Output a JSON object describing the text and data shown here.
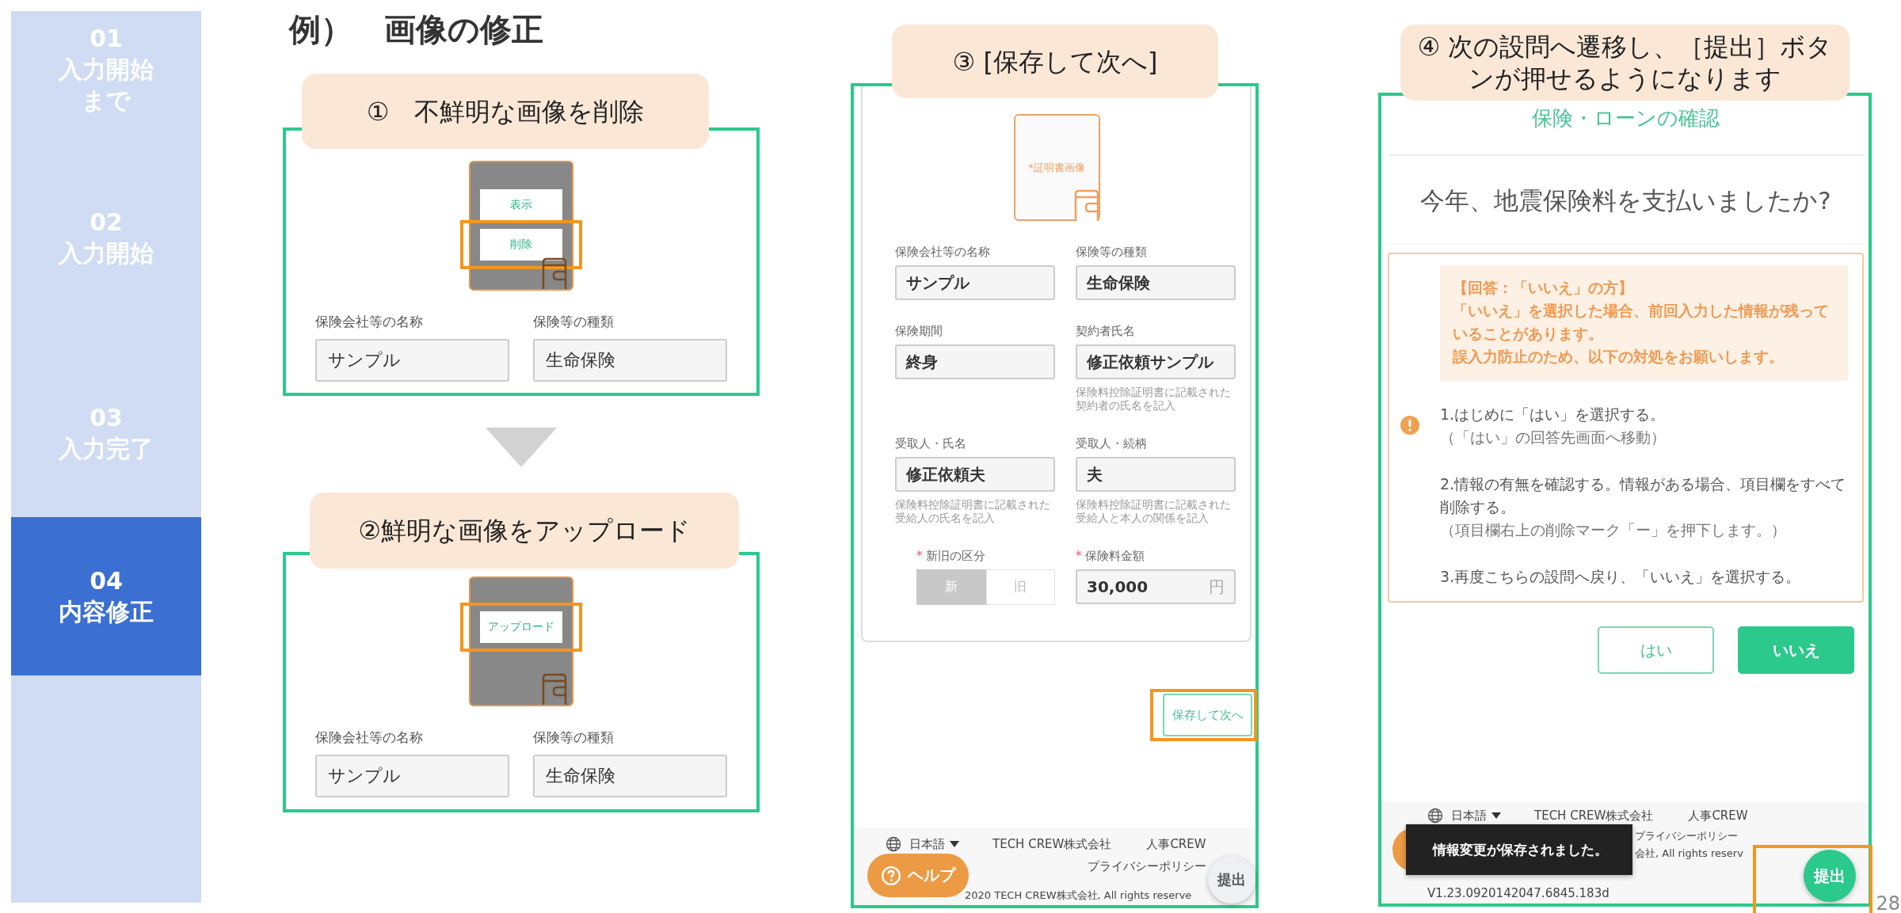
{
  "sidebar": {
    "steps": [
      {
        "number": "01",
        "label": "入力開始まで",
        "selected": false
      },
      {
        "number": "02",
        "label": "入力開始",
        "selected": false
      },
      {
        "number": "03",
        "label": "入力完了",
        "selected": false
      },
      {
        "number": "04",
        "label": "内容修正",
        "selected": true
      }
    ]
  },
  "title": "例）　画像の修正",
  "step_delete": {
    "callout": "①　不鮮明な画像を削除",
    "image_menu": [
      {
        "label": "表示",
        "highlighted": false
      },
      {
        "label": "削除",
        "highlighted": true
      }
    ],
    "fields": [
      {
        "label": "保険会社等の名称",
        "value": "サンプル"
      },
      {
        "label": "保険等の種類",
        "value": "生命保険"
      }
    ]
  },
  "step_upload": {
    "callout": "②鮮明な画像をアップロード",
    "upload_button": {
      "label": "アップロード",
      "highlighted": true
    },
    "fields": [
      {
        "label": "保険会社等の名称",
        "value": "サンプル"
      },
      {
        "label": "保険等の種類",
        "value": "生命保険"
      }
    ]
  },
  "step_save": {
    "callout": "③ [保存して次へ]",
    "image_placeholder": "*証明書画像",
    "fields": [
      {
        "label": "保険会社等の名称",
        "value": "サンプル"
      },
      {
        "label": "保険等の種類",
        "value": "生命保険"
      },
      {
        "label": "保険期間",
        "value": "終身"
      },
      {
        "label": "契約者氏名",
        "value": "修正依頼サンプル",
        "hint": "保険料控除証明書に記載された契約者の氏名を記入"
      },
      {
        "label": "受取人・氏名",
        "value": "修正依頼夫",
        "hint": "保険料控除証明書に記載された受給人の氏名を記入"
      },
      {
        "label": "受取人・続柄",
        "value": "夫",
        "hint": "保険料控除証明書に記載された受給人と本人の関係を記入"
      }
    ],
    "category": {
      "mark": "*",
      "label": "新旧の区分",
      "options": [
        {
          "label": "新",
          "selected": true
        },
        {
          "label": "旧",
          "selected": false
        }
      ]
    },
    "amount": {
      "mark": "*",
      "label": "保険料金額",
      "value": "30,000",
      "unit": "円"
    },
    "save_button": {
      "label": "保存して次へ",
      "highlighted": true
    },
    "footer": {
      "language": "日本語",
      "company": "TECH CREW株式会社",
      "service": "人事CREW",
      "privacy": "プライバシーポリシー",
      "copyright": "2020 TECH CREW株式会社, All rights reserve"
    },
    "help_button": "ヘルプ",
    "submit_button": {
      "label": "提出",
      "enabled": false
    }
  },
  "step_submit": {
    "callout": "④ 次の設問へ遷移し、［提出］ボタンが押せるようになります",
    "header": "保険・ローンの確認",
    "question": "今年、地震保険料を支払いましたか?",
    "note": [
      "【回答：「いいえ」の方】",
      "「いいえ」を選択した場合、前回入力した情報が残っていることがあります。",
      "誤入力防止のため、以下の対処をお願いします。"
    ],
    "instructions": [
      {
        "text": "1.はじめに「はい」を選択する。",
        "sub": "（「はい」の回答先画面へ移動）"
      },
      {
        "text": "2.情報の有無を確認する。情報がある場合、項目欄をすべて削除する。",
        "sub": "（項目欄右上の削除マーク「ー」を押下します。）"
      },
      {
        "text": "3.再度こちらの設問へ戻り、「いいえ」を選択する。"
      }
    ],
    "answers": [
      {
        "label": "はい",
        "selected": false
      },
      {
        "label": "いいえ",
        "selected": true
      }
    ],
    "footer": {
      "language": "日本語",
      "company": "TECH CREW株式会社",
      "service": "人事CREW",
      "privacy": "プライバシーポリシー",
      "copyright": "会社, All rights reserv",
      "version": "V1.23.0920142047.6845.183d"
    },
    "toast": "情報変更が保存されました。",
    "submit_button": {
      "label": "提出",
      "enabled": true,
      "highlighted": true
    }
  },
  "page_number": "28"
}
